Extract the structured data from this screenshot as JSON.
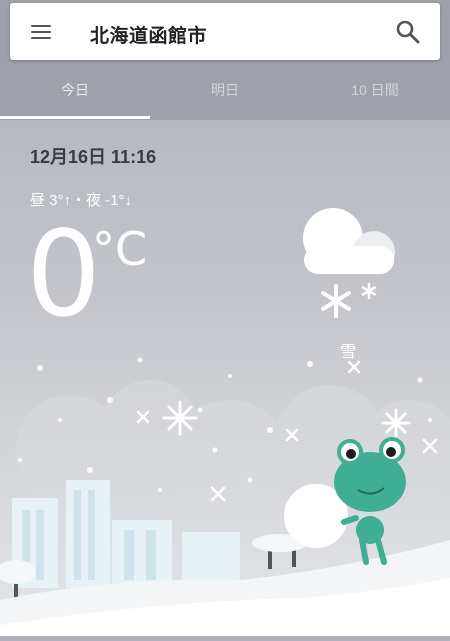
{
  "search": {
    "query": "北海道函館市"
  },
  "tabs": [
    {
      "label": "今日"
    },
    {
      "label": "明日"
    },
    {
      "label": "10 日間"
    }
  ],
  "weather": {
    "datetime": "12月16日 11:16",
    "hi_lo": "昼 3°↑・夜 -1°↓",
    "temperature": "0",
    "unit": "°C",
    "condition": "雪"
  },
  "icons": {
    "menu": "menu-icon",
    "search": "search-icon",
    "condition": "snow-cloud-icon"
  },
  "colors": {
    "header": "#9ea1a9",
    "text_dark": "#3a3b40",
    "frog": "#3fae92"
  }
}
